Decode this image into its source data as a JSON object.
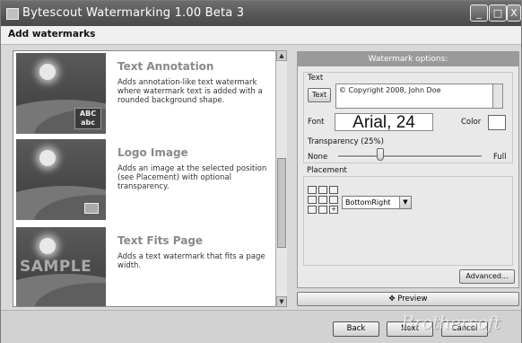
{
  "window": {
    "title": "Bytescout Watermarking 1.00 Beta 3",
    "minimize_glyph": "_",
    "maximize_glyph": "□",
    "close_glyph": "X"
  },
  "header": {
    "title": "Add watermarks"
  },
  "watermark_types": [
    {
      "title": "Text Annotation",
      "description": "Adds annotation-like text watermark where watermark text is added with a rounded background shape.",
      "badge_line1": "ABC",
      "badge_line2": "abc"
    },
    {
      "title": "Logo Image",
      "description": "Adds an image at the selected position (see Placement) with optional transparency."
    },
    {
      "title": "Text Fits Page",
      "description": "Adds a text watermark that fits a page width.",
      "overlay_text": "SAMPLE"
    }
  ],
  "options": {
    "header": "Watermark options:",
    "text_group_label": "Text",
    "text_button": "Text",
    "text_value": "© Copyright 2008, John Doe",
    "font_label": "Font",
    "font_value": "Arial, 24",
    "color_label": "Color",
    "transparency_label": "Transparency (25%)",
    "transparency_value": 0.25,
    "slider_min_label": "None",
    "slider_max_label": "Full",
    "placement_label": "Placement",
    "placement_value": "BottomRight",
    "advanced_button": "Advanced..."
  },
  "preview_button": "Preview",
  "footer": {
    "back": "Back",
    "next": "Next",
    "cancel": "Cancel"
  },
  "site_watermark": "Brothersoft",
  "icons": {
    "scroll_up": "▲",
    "scroll_down": "▼",
    "dropdown": "▼",
    "preview": "✥",
    "selected_cell": "+"
  }
}
